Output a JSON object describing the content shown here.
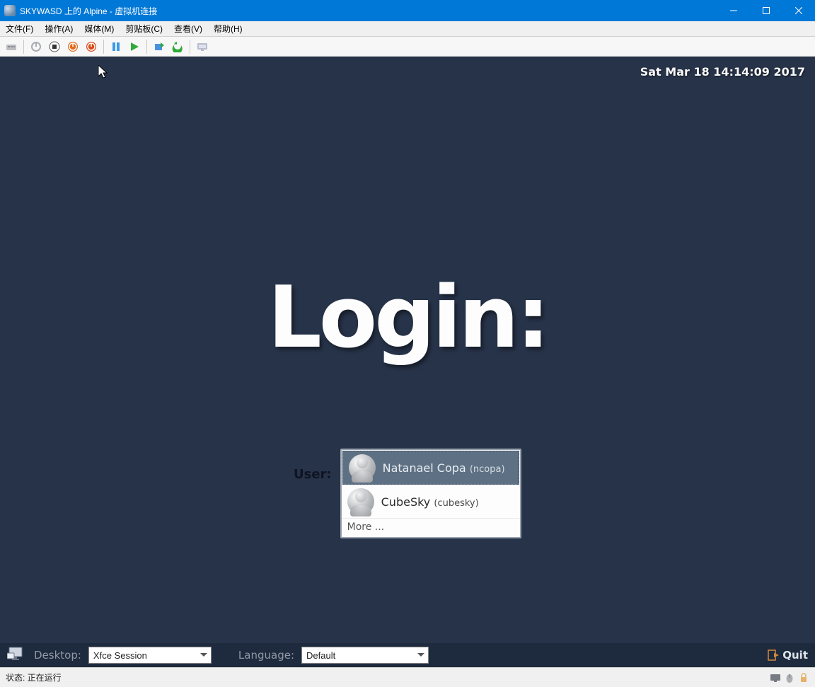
{
  "window": {
    "title": "SKYWASD 上的 Alpine - 虚拟机连接"
  },
  "menu": {
    "items": [
      "文件(F)",
      "操作(A)",
      "媒体(M)",
      "剪贴板(C)",
      "查看(V)",
      "帮助(H)"
    ]
  },
  "toolbar": {
    "icons": [
      "ctrl-alt-del",
      "power-off",
      "shutdown",
      "turnoff-orange",
      "reset-orange",
      "pause",
      "start",
      "checkpoint",
      "revert",
      "enhanced-session"
    ]
  },
  "guest": {
    "clock": "Sat Mar 18 14:14:09 2017",
    "login_title": "Login:",
    "user_label": "User:",
    "users": [
      {
        "name": "Natanael Copa",
        "login": "(ncopa)",
        "selected": true
      },
      {
        "name": "CubeSky",
        "login": "(cubesky)",
        "selected": false
      }
    ],
    "more": "More ...",
    "bar": {
      "desktop_label": "Desktop:",
      "desktop_value": "Xfce Session",
      "language_label": "Language:",
      "language_value": "Default",
      "quit": "Quit"
    }
  },
  "status": {
    "text": "状态: 正在运行"
  }
}
